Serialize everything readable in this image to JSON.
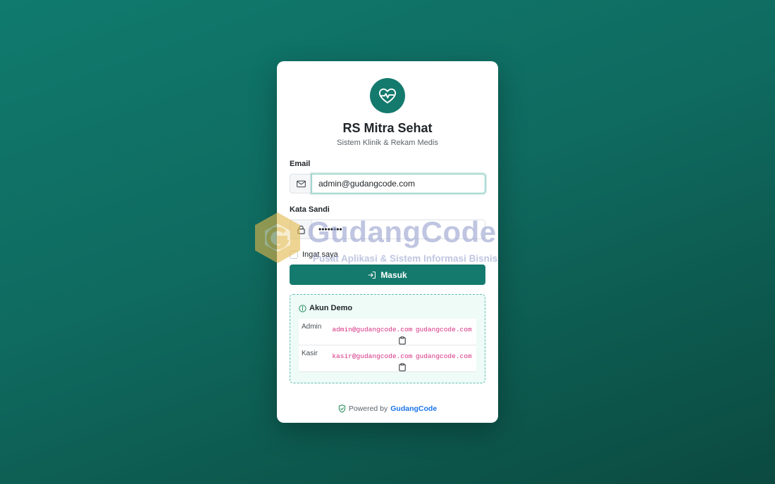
{
  "brand": {
    "title": "RS Mitra Sehat",
    "subtitle": "Sistem Klinik & Rekam Medis",
    "logo_icon": "heart-pulse-icon",
    "accent_color": "#147a6d"
  },
  "form": {
    "email_label": "Email",
    "email_value": "admin@gudangcode.com",
    "password_label": "Kata Sandi",
    "password_value": "••••••••",
    "remember_label": "Ingat saya",
    "remember_checked": false,
    "submit_label": "Masuk"
  },
  "demo": {
    "title": "Akun Demo",
    "accounts": [
      {
        "role": "Admin",
        "email": "admin@gudangcode.com",
        "password": "gudangcode.com"
      },
      {
        "role": "Kasir",
        "email": "kasir@gudangcode.com",
        "password": "gudangcode.com"
      }
    ]
  },
  "footer": {
    "prefix": "Powered by",
    "link": "GudangCode"
  },
  "watermark": {
    "title": "GudangCode",
    "subtitle": "Pusat Aplikasi & Sistem Informasi Bisnis"
  }
}
